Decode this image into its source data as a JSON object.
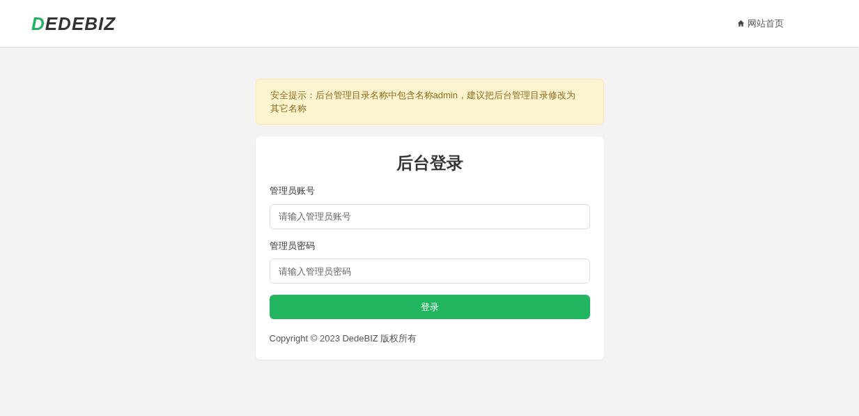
{
  "header": {
    "logo": "DEDEBIZ",
    "home_link": "网站首页"
  },
  "alert": {
    "text": "安全提示：后台管理目录名称中包含名称admin，建议把后台管理目录修改为其它名称"
  },
  "login": {
    "title": "后台登录",
    "fields": [
      {
        "label": "管理员账号",
        "placeholder": "请输入管理员账号"
      },
      {
        "label": "管理员密码",
        "placeholder": "请输入管理员密码"
      }
    ],
    "submit": "登录",
    "copyright": "Copyright © 2023 DedeBIZ 版权所有"
  }
}
